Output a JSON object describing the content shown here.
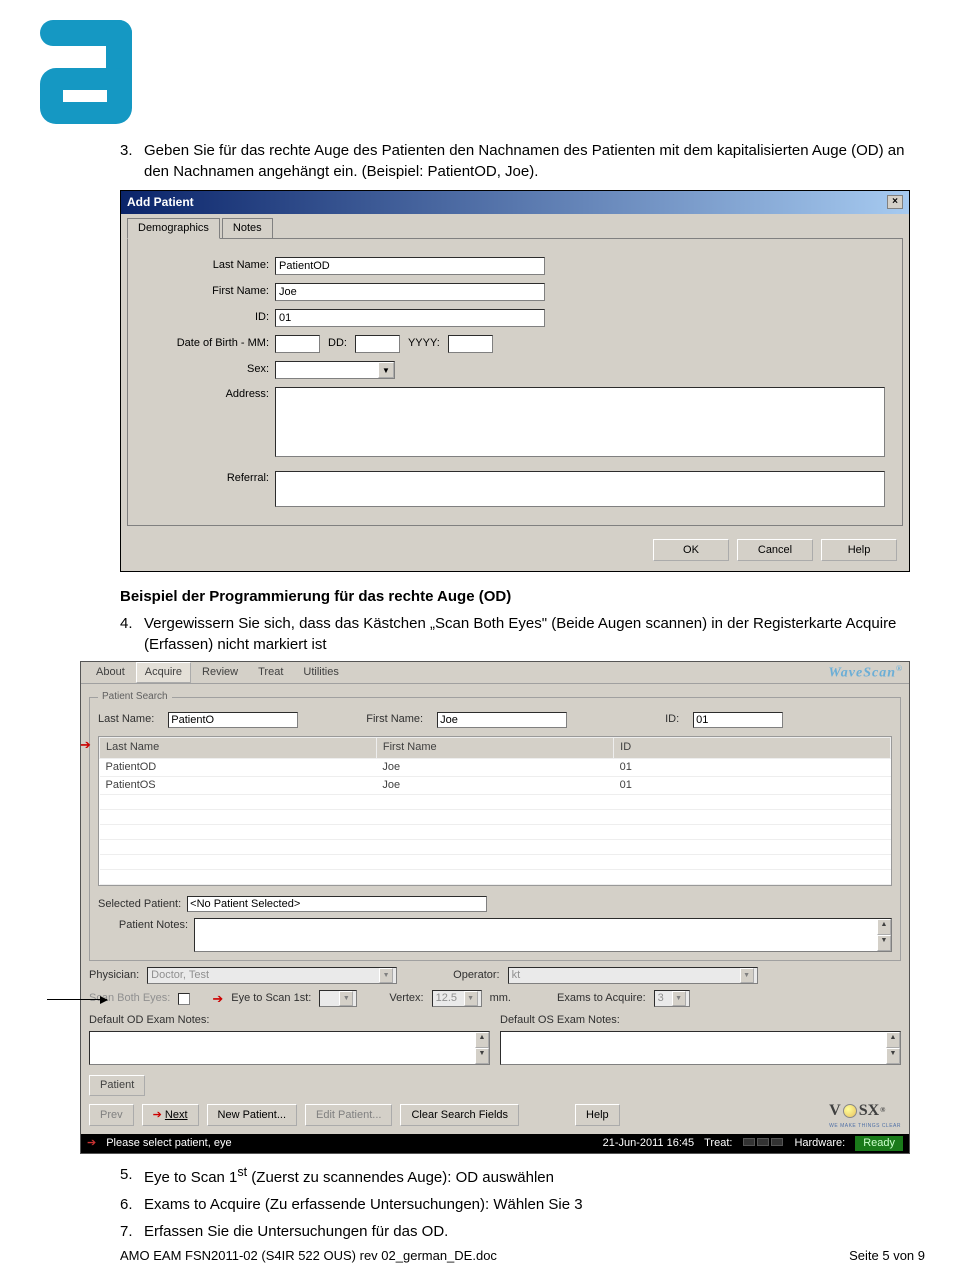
{
  "logo_alt": "Abbott",
  "steps": {
    "s3_num": "3.",
    "s3_text": "Geben Sie für das rechte Auge des Patienten den Nachnamen des Patienten mit dem kapitalisierten Auge (OD) an den Nachnamen angehängt ein. (Beispiel: PatientOD, Joe).",
    "s4_intro": "Beispiel der Programmierung für das rechte Auge (OD)",
    "s4_num": "4.",
    "s4_text": "Vergewissern Sie sich, dass das Kästchen „Scan Both Eyes\" (Beide Augen scannen) in der Registerkarte Acquire (Erfassen) nicht markiert ist",
    "s5_num": "5.",
    "s5_text_a": "Eye to Scan 1",
    "s5_sup": "st",
    "s5_text_b": " (Zuerst zu scannendes Auge): OD auswählen",
    "s6_num": "6.",
    "s6_text": "Exams to Acquire (Zu erfassende Untersuchungen): Wählen Sie 3",
    "s7_num": "7.",
    "s7_text": "Erfassen Sie die Untersuchungen für das OD."
  },
  "dialog": {
    "title": "Add Patient",
    "tabs": {
      "demographics": "Demographics",
      "notes": "Notes"
    },
    "labels": {
      "last": "Last Name:",
      "first": "First Name:",
      "id": "ID:",
      "dob": "Date of Birth - MM:",
      "dd": "DD:",
      "yyyy": "YYYY:",
      "sex": "Sex:",
      "address": "Address:",
      "referral": "Referral:"
    },
    "values": {
      "last": "PatientOD",
      "first": "Joe",
      "id": "01"
    },
    "buttons": {
      "ok": "OK",
      "cancel": "Cancel",
      "help": "Help"
    }
  },
  "wavescan": {
    "menu": {
      "about": "About",
      "acquire": "Acquire",
      "review": "Review",
      "treat": "Treat",
      "utilities": "Utilities"
    },
    "brand": "WaveScan",
    "panel_title": "Patient Search",
    "search": {
      "last_lbl": "Last Name:",
      "last_val": "PatientO",
      "first_lbl": "First Name:",
      "first_val": "Joe",
      "id_lbl": "ID:",
      "id_val": "01"
    },
    "table": {
      "cols": [
        "Last Name",
        "First Name",
        "ID"
      ],
      "rows": [
        [
          "PatientOD",
          "Joe",
          "01"
        ],
        [
          "PatientOS",
          "Joe",
          "01"
        ]
      ]
    },
    "selected_lbl": "Selected Patient:",
    "selected_val": "<No Patient Selected>",
    "patient_notes_lbl": "Patient Notes:",
    "physician_lbl": "Physician:",
    "physician_val": "Doctor, Test",
    "operator_lbl": "Operator:",
    "operator_val": "kt",
    "scan_both_lbl": "Scan Both Eyes:",
    "eye_first_lbl": "Eye to Scan 1st:",
    "vertex_lbl": "Vertex:",
    "vertex_val": "12.5",
    "vertex_unit": "mm.",
    "exams_lbl": "Exams to Acquire:",
    "exams_val": "3",
    "default_od_lbl": "Default OD Exam Notes:",
    "default_os_lbl": "Default OS Exam Notes:",
    "patient_tab": "Patient",
    "buttons": {
      "prev": "Prev",
      "next": "Next",
      "new": "New Patient...",
      "edit": "Edit Patient...",
      "clear": "Clear Search Fields",
      "help": "Help"
    },
    "logo": {
      "text": "VISX",
      "tag": "WE MAKE THINGS CLEAR"
    },
    "status": {
      "msg": "Please select patient, eye",
      "date": "21-Jun-2011 16:45",
      "treat_lbl": "Treat:",
      "hw_lbl": "Hardware:",
      "hw_val": "Ready"
    }
  },
  "footer": {
    "left": "AMO EAM FSN2011-02 (S4IR 522 OUS) rev 02_german_DE.doc",
    "right": "Seite 5 von 9"
  }
}
